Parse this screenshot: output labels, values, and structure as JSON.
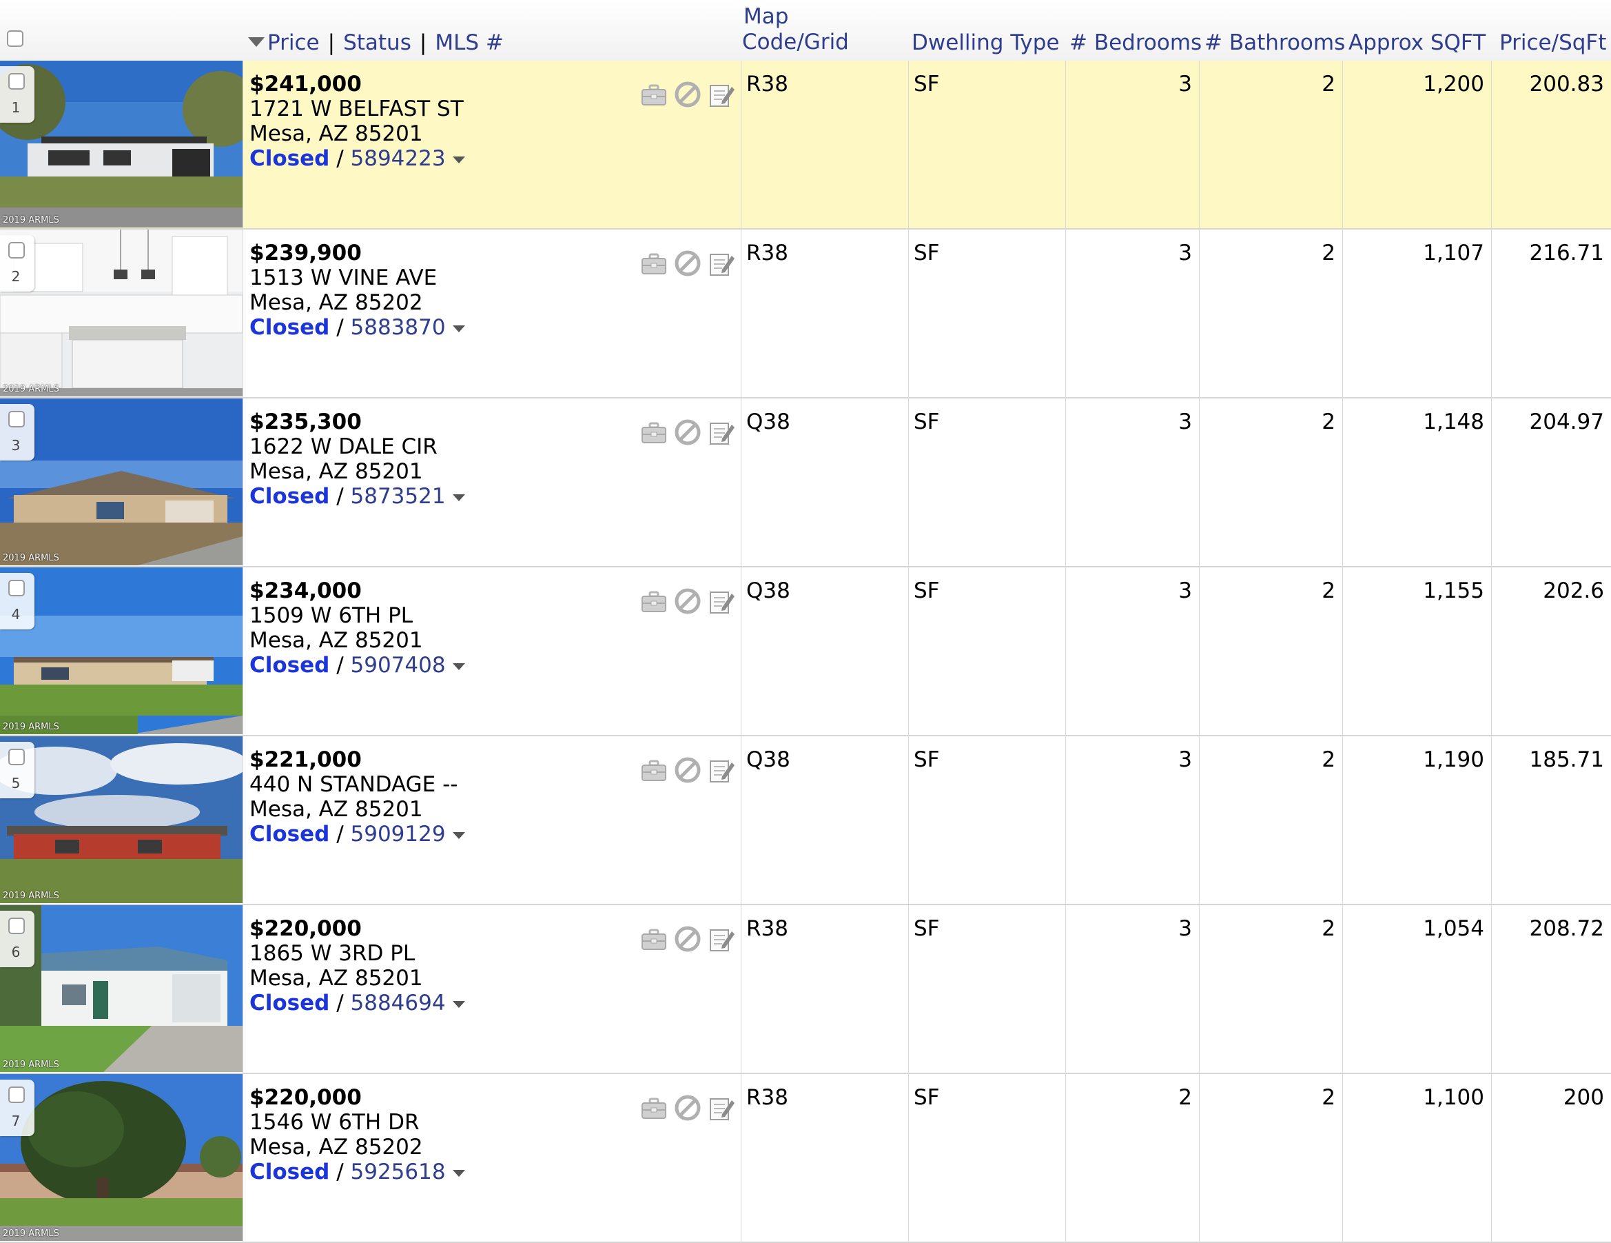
{
  "header": {
    "price": "Price",
    "status": "Status",
    "mls": "MLS #",
    "separator": "|",
    "map_line1": "Map",
    "map_line2": "Code/Grid",
    "dwelling": "Dwelling Type",
    "bedrooms": "# Bedrooms",
    "bathrooms": "# Bathrooms",
    "sqft": "Approx SQFT",
    "price_sqft": "Price/SqFt"
  },
  "watermark": "2019 ARMLS",
  "icons": [
    "briefcase-icon",
    "no-entry-icon",
    "edit-note-icon"
  ],
  "status_separator": "/",
  "listings": [
    {
      "num": "1",
      "price": "$241,000",
      "street": "1721 W BELFAST ST",
      "city": "Mesa, AZ 85201",
      "status": "Closed",
      "mls": "5894223",
      "map": "R38",
      "dwelling": "SF",
      "beds": "3",
      "baths": "2",
      "sqft": "1,200",
      "ppsf": "200.83",
      "highlighted": true,
      "photo": "house-front-dark-roof"
    },
    {
      "num": "2",
      "price": "$239,900",
      "street": "1513 W VINE AVE",
      "city": "Mesa, AZ 85202",
      "status": "Closed",
      "mls": "5883870",
      "map": "R38",
      "dwelling": "SF",
      "beds": "3",
      "baths": "2",
      "sqft": "1,107",
      "ppsf": "216.71",
      "highlighted": false,
      "photo": "white-kitchen"
    },
    {
      "num": "3",
      "price": "$235,300",
      "street": "1622 W DALE CIR",
      "city": "Mesa, AZ 85201",
      "status": "Closed",
      "mls": "5873521",
      "map": "Q38",
      "dwelling": "SF",
      "beds": "3",
      "baths": "2",
      "sqft": "1,148",
      "ppsf": "204.97",
      "highlighted": false,
      "photo": "house-dirt-yard"
    },
    {
      "num": "4",
      "price": "$234,000",
      "street": "1509 W 6TH PL",
      "city": "Mesa, AZ 85201",
      "status": "Closed",
      "mls": "5907408",
      "map": "Q38",
      "dwelling": "SF",
      "beds": "3",
      "baths": "2",
      "sqft": "1,155",
      "ppsf": "202.6",
      "highlighted": false,
      "photo": "house-green-lawn"
    },
    {
      "num": "5",
      "price": "$221,000",
      "street": "440 N STANDAGE --",
      "city": "Mesa, AZ 85201",
      "status": "Closed",
      "mls": "5909129",
      "map": "Q38",
      "dwelling": "SF",
      "beds": "3",
      "baths": "2",
      "sqft": "1,190",
      "ppsf": "185.71",
      "highlighted": false,
      "photo": "red-house-cloudy-sky"
    },
    {
      "num": "6",
      "price": "$220,000",
      "street": "1865 W 3RD PL",
      "city": "Mesa, AZ 85201",
      "status": "Closed",
      "mls": "5884694",
      "map": "R38",
      "dwelling": "SF",
      "beds": "3",
      "baths": "2",
      "sqft": "1,054",
      "ppsf": "208.72",
      "highlighted": false,
      "photo": "white-house-driveway"
    },
    {
      "num": "7",
      "price": "$220,000",
      "street": "1546 W 6TH DR",
      "city": "Mesa, AZ 85202",
      "status": "Closed",
      "mls": "5925618",
      "map": "R38",
      "dwelling": "SF",
      "beds": "2",
      "baths": "2",
      "sqft": "1,100",
      "ppsf": "200",
      "highlighted": false,
      "photo": "house-behind-tree"
    }
  ]
}
